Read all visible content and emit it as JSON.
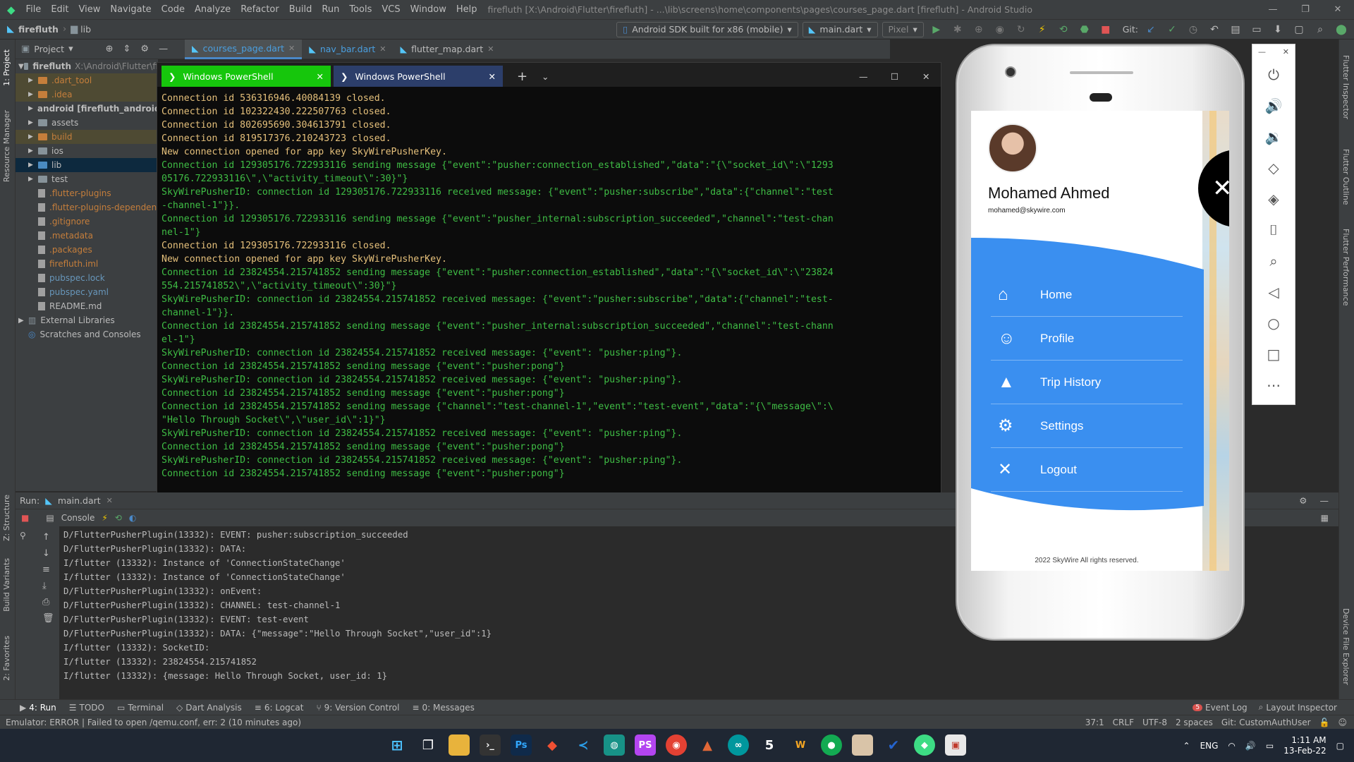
{
  "titlebar": {
    "menu": [
      "File",
      "Edit",
      "View",
      "Navigate",
      "Code",
      "Analyze",
      "Refactor",
      "Build",
      "Run",
      "Tools",
      "VCS",
      "Window",
      "Help"
    ],
    "title": "firefluth [X:\\Android\\Flutter\\firefluth] - ...\\lib\\screens\\home\\components\\pages\\courses_page.dart [firefluth] - Android Studio"
  },
  "navbar": {
    "crumb1": "firefluth",
    "crumb2": "lib",
    "device": "Android SDK built for x86 (mobile)",
    "config": "main.dart",
    "pixel": "Pixel",
    "git_label": "Git:"
  },
  "project": {
    "header": "Project",
    "root": "firefluth",
    "root_path": "X:\\Android\\Flutter\\fi",
    "items": [
      ".dart_tool",
      ".idea",
      "android [firefluth_android]",
      "assets",
      "build",
      "ios",
      "lib",
      "test",
      ".flutter-plugins",
      ".flutter-plugins-dependen",
      ".gitignore",
      ".metadata",
      ".packages",
      "firefluth.iml",
      "pubspec.lock",
      "pubspec.yaml",
      "README.md"
    ],
    "external": "External Libraries",
    "scratches": "Scratches and Consoles"
  },
  "editor_tabs": [
    "courses_page.dart",
    "nav_bar.dart",
    "flutter_map.dart"
  ],
  "left_stripe": [
    "1: Project",
    "Resource Manager",
    "Z: Structure",
    "Build Variants",
    "2: Favorites"
  ],
  "right_stripe": [
    "Flutter Inspector",
    "Flutter Outline",
    "Flutter Performance",
    "Device File Explorer"
  ],
  "powershell": {
    "tab1": "Windows PowerShell",
    "tab2": "Windows PowerShell",
    "lines": [
      {
        "c": "#e5c07b",
        "t": "Connection id 536316946.40084139 closed."
      },
      {
        "c": "#e5c07b",
        "t": "Connection id 102322430.222507763 closed."
      },
      {
        "c": "#e5c07b",
        "t": "Connection id 802695690.304613791 closed."
      },
      {
        "c": "#e5c07b",
        "t": "Connection id 819517376.210243723 closed."
      },
      {
        "c": "#e5c07b",
        "t": "New connection opened for app key SkyWirePusherKey."
      },
      {
        "c": "#3fbd45",
        "t": "Connection id 129305176.722933116 sending message {\"event\":\"pusher:connection_established\",\"data\":\"{\\\"socket_id\\\":\\\"1293"
      },
      {
        "c": "#3fbd45",
        "t": "05176.722933116\\\",\\\"activity_timeout\\\":30}\"}"
      },
      {
        "c": "#3fbd45",
        "t": "SkyWirePusherID: connection id 129305176.722933116 received message: {\"event\":\"pusher:subscribe\",\"data\":{\"channel\":\"test"
      },
      {
        "c": "#3fbd45",
        "t": "-channel-1\"}}."
      },
      {
        "c": "#3fbd45",
        "t": "Connection id 129305176.722933116 sending message {\"event\":\"pusher_internal:subscription_succeeded\",\"channel\":\"test-chan"
      },
      {
        "c": "#3fbd45",
        "t": "nel-1\"}"
      },
      {
        "c": "#e5c07b",
        "t": "Connection id 129305176.722933116 closed."
      },
      {
        "c": "#e5c07b",
        "t": "New connection opened for app key SkyWirePusherKey."
      },
      {
        "c": "#3fbd45",
        "t": "Connection id 23824554.215741852 sending message {\"event\":\"pusher:connection_established\",\"data\":\"{\\\"socket_id\\\":\\\"23824"
      },
      {
        "c": "#3fbd45",
        "t": "554.215741852\\\",\\\"activity_timeout\\\":30}\"}"
      },
      {
        "c": "#3fbd45",
        "t": "SkyWirePusherID: connection id 23824554.215741852 received message: {\"event\":\"pusher:subscribe\",\"data\":{\"channel\":\"test-"
      },
      {
        "c": "#3fbd45",
        "t": "channel-1\"}}."
      },
      {
        "c": "#3fbd45",
        "t": "Connection id 23824554.215741852 sending message {\"event\":\"pusher_internal:subscription_succeeded\",\"channel\":\"test-chann"
      },
      {
        "c": "#3fbd45",
        "t": "el-1\"}"
      },
      {
        "c": "#3fbd45",
        "t": "SkyWirePusherID: connection id 23824554.215741852 received message: {\"event\": \"pusher:ping\"}."
      },
      {
        "c": "#3fbd45",
        "t": "Connection id 23824554.215741852 sending message {\"event\":\"pusher:pong\"}"
      },
      {
        "c": "#3fbd45",
        "t": "SkyWirePusherID: connection id 23824554.215741852 received message: {\"event\": \"pusher:ping\"}."
      },
      {
        "c": "#3fbd45",
        "t": "Connection id 23824554.215741852 sending message {\"event\":\"pusher:pong\"}"
      },
      {
        "c": "#3fbd45",
        "t": "Connection id 23824554.215741852 sending message {\"channel\":\"test-channel-1\",\"event\":\"test-event\",\"data\":\"{\\\"message\\\":\\"
      },
      {
        "c": "#3fbd45",
        "t": "\"Hello Through Socket\\\",\\\"user_id\\\":1}\"}"
      },
      {
        "c": "#3fbd45",
        "t": "SkyWirePusherID: connection id 23824554.215741852 received message: {\"event\": \"pusher:ping\"}."
      },
      {
        "c": "#3fbd45",
        "t": "Connection id 23824554.215741852 sending message {\"event\":\"pusher:pong\"}"
      },
      {
        "c": "#3fbd45",
        "t": "SkyWirePusherID: connection id 23824554.215741852 received message: {\"event\": \"pusher:ping\"}."
      },
      {
        "c": "#3fbd45",
        "t": "Connection id 23824554.215741852 sending message {\"event\":\"pusher:pong\"}"
      }
    ]
  },
  "run": {
    "label": "Run:",
    "tab": "main.dart",
    "console_tab": "Console",
    "lines": [
      "D/FlutterPusherPlugin(13332): EVENT: pusher:subscription_succeeded",
      "D/FlutterPusherPlugin(13332): DATA:",
      "I/flutter (13332): Instance of 'ConnectionStateChange'",
      "I/flutter (13332): Instance of 'ConnectionStateChange'",
      "D/FlutterPusherPlugin(13332): onEvent:",
      "D/FlutterPusherPlugin(13332): CHANNEL: test-channel-1",
      "D/FlutterPusherPlugin(13332): EVENT: test-event",
      "D/FlutterPusherPlugin(13332): DATA: {\"message\":\"Hello Through Socket\",\"user_id\":1}",
      "I/flutter (13332): SocketID:",
      "I/flutter (13332): 23824554.215741852",
      "I/flutter (13332): {message: Hello Through Socket, user_id: 1}"
    ]
  },
  "bottom_tools": [
    "4: Run",
    "TODO",
    "Terminal",
    "Dart Analysis",
    "6: Logcat",
    "9: Version Control",
    "0: Messages"
  ],
  "bottom_right": [
    "Event Log",
    "Layout Inspector"
  ],
  "event_log_count": "5",
  "status": {
    "message": "Emulator: ERROR  | Failed to open /qemu.conf, err: 2 (10 minutes ago)",
    "pos": "37:1",
    "eol": "CRLF",
    "enc": "UTF-8",
    "indent": "2 spaces",
    "git": "Git: CustomAuthUser"
  },
  "phone": {
    "name": "Mohamed Ahmed",
    "email": "mohamed@skywire.com",
    "menu": [
      {
        "label": "Home",
        "icon": "home-icon"
      },
      {
        "label": "Profile",
        "icon": "profile-icon"
      },
      {
        "label": "Trip History",
        "icon": "navigation-icon"
      },
      {
        "label": "Settings",
        "icon": "settings-icon"
      },
      {
        "label": "Logout",
        "icon": "close-icon"
      }
    ],
    "footer": "2022 SkyWire All rights reserved.",
    "drawer_color": "#3a8ff0"
  },
  "taskbar": {
    "lang": "ENG",
    "time": "1:11 AM",
    "date": "13-Feb-22"
  }
}
